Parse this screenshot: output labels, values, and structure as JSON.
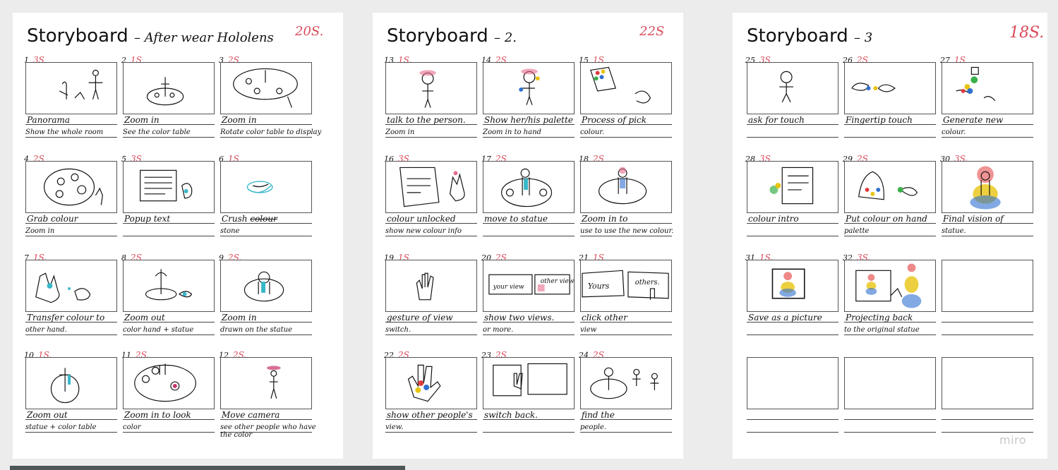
{
  "sheets": [
    {
      "title": "Storyboard",
      "subtitle": "– After wear Hololens",
      "time": "20S.",
      "frames": [
        {
          "num": "1",
          "dur": "3S",
          "caption": "Panorama",
          "sub": "Show the whole room"
        },
        {
          "num": "2",
          "dur": "1S",
          "caption": "Zoom in",
          "sub": "See the color table"
        },
        {
          "num": "3",
          "dur": "2S",
          "caption": "Zoom in",
          "sub": "Rotate color table to display"
        },
        {
          "num": "4",
          "dur": "2S",
          "caption": "Grab colour",
          "sub": "Zoom in"
        },
        {
          "num": "5",
          "dur": "3S",
          "caption": "Popup text",
          "sub": ""
        },
        {
          "num": "6",
          "dur": "1S",
          "caption": "Crush colour",
          "sub": "stone"
        },
        {
          "num": "7",
          "dur": "1S.",
          "caption": "Transfer colour to",
          "sub": "other hand."
        },
        {
          "num": "8",
          "dur": "2S",
          "caption": "Zoom out",
          "sub": "color hand + statue"
        },
        {
          "num": "9",
          "dur": "2S.",
          "caption": "Zoom in",
          "sub": "drawn on the statue"
        },
        {
          "num": "10",
          "dur": "1S.",
          "caption": "Zoom out",
          "sub": "statue + color table"
        },
        {
          "num": "11",
          "dur": "2S.",
          "caption": "Zoom in to look",
          "sub": "color"
        },
        {
          "num": "12",
          "dur": "2S.",
          "caption": "Move camera",
          "sub": "see other people who have the color"
        }
      ]
    },
    {
      "title": "Storyboard",
      "subtitle": "– 2.",
      "time": "22S",
      "frames": [
        {
          "num": "13",
          "dur": "1S.",
          "caption": "talk to the person.",
          "sub": "Zoom in"
        },
        {
          "num": "14",
          "dur": "2S",
          "caption": "Show her/his palette",
          "sub": "Zoom in to hand"
        },
        {
          "num": "15",
          "dur": "1S",
          "caption": "Process of pick",
          "sub": "colour."
        },
        {
          "num": "16",
          "dur": "3S",
          "caption": "colour unlocked",
          "sub": "show new colour info"
        },
        {
          "num": "17",
          "dur": "2S",
          "caption": "move to statue",
          "sub": ""
        },
        {
          "num": "18",
          "dur": "2S",
          "caption": "Zoom in to",
          "sub": "use to use the new colour."
        },
        {
          "num": "19",
          "dur": "1S",
          "caption": "gesture of view",
          "sub": "switch."
        },
        {
          "num": "20",
          "dur": "2S",
          "caption": "show two views.",
          "sub": "or more."
        },
        {
          "num": "21",
          "dur": "1S",
          "caption": "click other",
          "sub": "view"
        },
        {
          "num": "22",
          "dur": "2S",
          "caption": "show other people's",
          "sub": "view."
        },
        {
          "num": "23",
          "dur": "2S",
          "caption": "switch back.",
          "sub": ""
        },
        {
          "num": "24",
          "dur": "2S",
          "caption": "find the",
          "sub": "people."
        }
      ],
      "panel_text": {
        "your_view": "your view",
        "other_view": "other view",
        "yours": "Yours",
        "others": "others."
      }
    },
    {
      "title": "Storyboard",
      "subtitle": "– 3",
      "time": "18S.",
      "frames": [
        {
          "num": "25",
          "dur": "3S",
          "caption": "ask for touch",
          "sub": ""
        },
        {
          "num": "26",
          "dur": "2S",
          "caption": "Fingertip touch",
          "sub": ""
        },
        {
          "num": "27",
          "dur": "1S",
          "caption": "Generate new",
          "sub": "colour."
        },
        {
          "num": "28",
          "dur": "3S",
          "caption": "colour intro",
          "sub": ""
        },
        {
          "num": "29",
          "dur": "2S",
          "caption": "Put colour on hand",
          "sub": "palette"
        },
        {
          "num": "30",
          "dur": "3S.",
          "caption": "Final vision of",
          "sub": "statue."
        },
        {
          "num": "31",
          "dur": "1S.",
          "caption": "Save as a picture",
          "sub": ""
        },
        {
          "num": "32",
          "dur": "3S.",
          "caption": "Projecting back",
          "sub": "to the original statue"
        },
        {
          "num": "",
          "dur": "",
          "caption": "",
          "sub": ""
        },
        {
          "num": "",
          "dur": "",
          "caption": "",
          "sub": ""
        },
        {
          "num": "",
          "dur": "",
          "caption": "",
          "sub": ""
        },
        {
          "num": "",
          "dur": "",
          "caption": "",
          "sub": ""
        }
      ]
    }
  ],
  "watermark": "miro",
  "colors": {
    "time_red": "#d94a5a",
    "ink": "#111111",
    "sheet_bg": "#ffffff",
    "page_bg": "#ececec"
  }
}
